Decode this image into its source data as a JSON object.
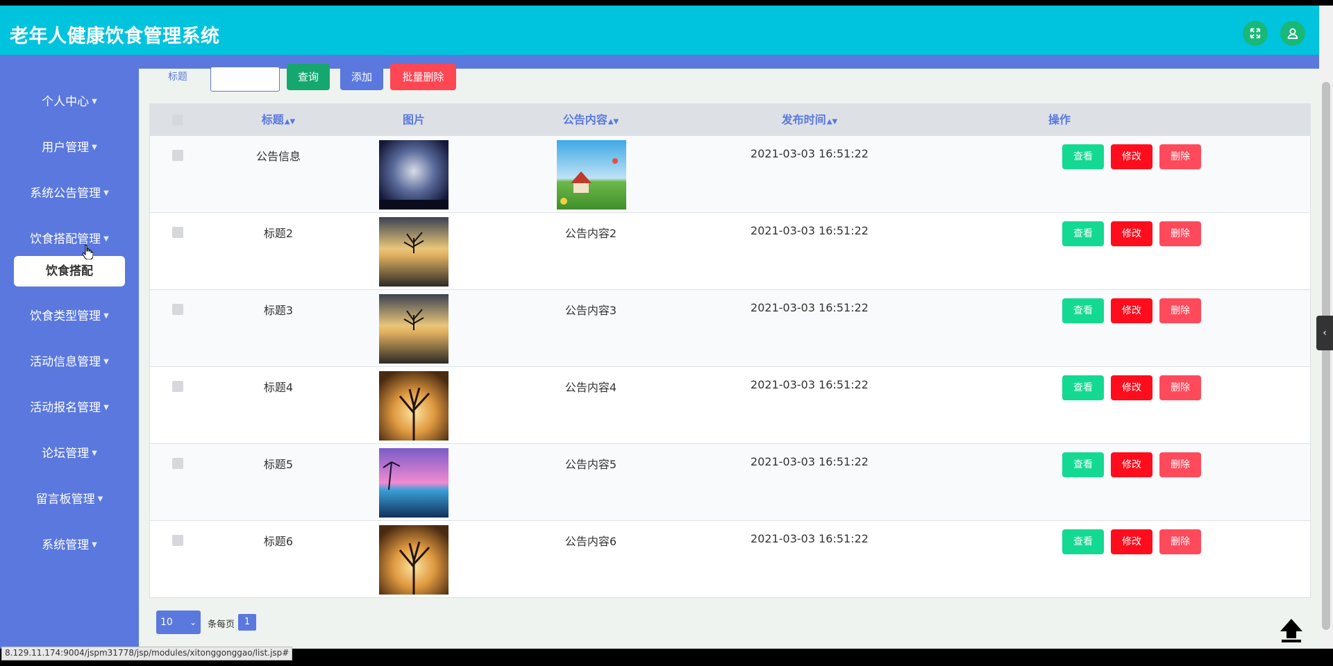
{
  "app": {
    "title": "老年人健康饮食管理系统"
  },
  "header": {
    "fullscreen_icon": "expand-icon",
    "user_icon": "user-icon"
  },
  "sidebar": {
    "items": [
      {
        "label": "个人中心"
      },
      {
        "label": "用户管理"
      },
      {
        "label": "系统公告管理"
      },
      {
        "label": "饮食搭配管理"
      },
      {
        "label": "饮食类型管理"
      },
      {
        "label": "活动信息管理"
      },
      {
        "label": "活动报名管理"
      },
      {
        "label": "论坛管理"
      },
      {
        "label": "留言板管理"
      },
      {
        "label": "系统管理"
      }
    ],
    "submenu": {
      "label": "饮食搭配"
    }
  },
  "search": {
    "label": "标题",
    "value": "",
    "query_label": "查询",
    "add_label": "添加",
    "batch_delete_label": "批量删除"
  },
  "table": {
    "headers": {
      "title": "标题",
      "image": "图片",
      "content": "公告内容",
      "time": "发布时间",
      "actions": "操作"
    },
    "rows": [
      {
        "title": "公告信息",
        "content": "",
        "time": "2021-03-03 16:51:22",
        "image_style": "night-sky",
        "content_image": "landscape"
      },
      {
        "title": "标题2",
        "content": "公告内容2",
        "time": "2021-03-03 16:51:22",
        "image_style": "lake-tree"
      },
      {
        "title": "标题3",
        "content": "公告内容3",
        "time": "2021-03-03 16:51:22",
        "image_style": "lake-tree"
      },
      {
        "title": "标题4",
        "content": "公告内容4",
        "time": "2021-03-03 16:51:22",
        "image_style": "sunset-tree"
      },
      {
        "title": "标题5",
        "content": "公告内容5",
        "time": "2021-03-03 16:51:22",
        "image_style": "purple-sunset"
      },
      {
        "title": "标题6",
        "content": "公告内容6",
        "time": "2021-03-03 16:51:22",
        "image_style": "sunset-tree"
      }
    ],
    "actions": {
      "view": "查看",
      "edit": "修改",
      "delete": "删除"
    }
  },
  "pager": {
    "page_size": "10",
    "per_page_label": "条每页",
    "current_page": "1"
  },
  "status_url": "8.129.11.174:9004/jspm31778/jsp/modules/xitonggonggao/list.jsp#",
  "colors": {
    "header": "#00c3dd",
    "sidebar": "#5a78de",
    "view": "#14d993",
    "edit": "#ff0d1d",
    "delete": "#ff4a5c"
  }
}
